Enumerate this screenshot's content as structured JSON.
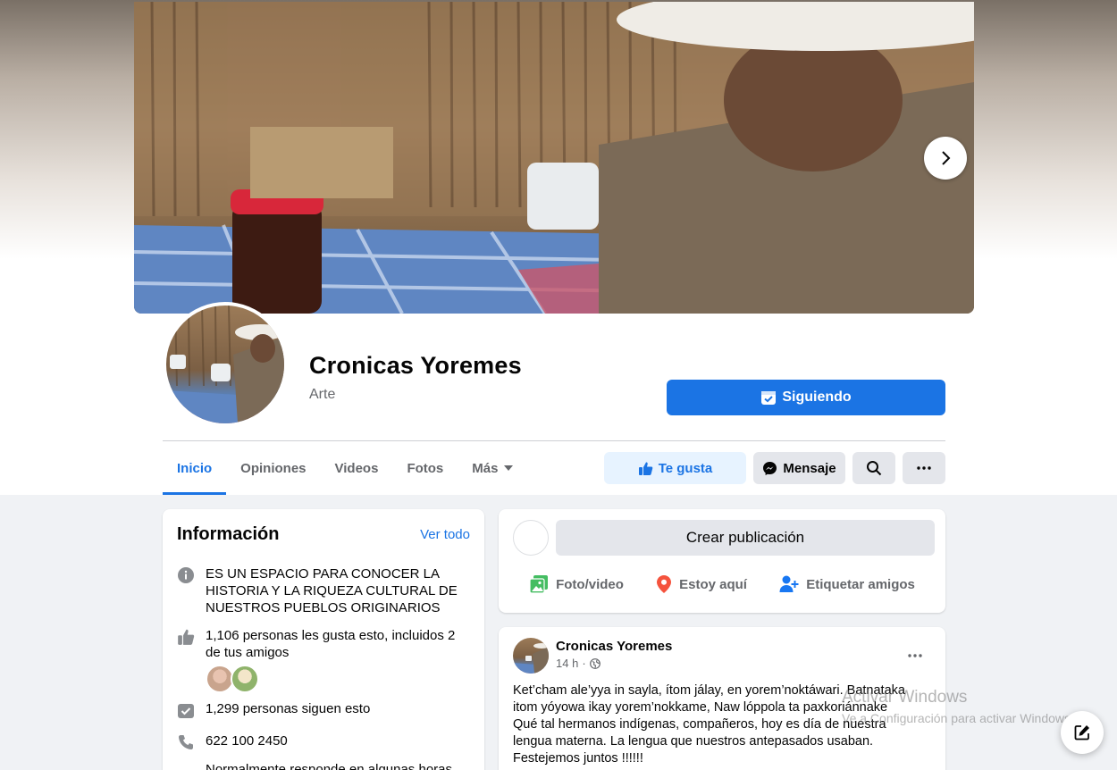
{
  "page": {
    "name": "Cronicas Yoremes",
    "category": "Arte",
    "following_label": "Siguiendo"
  },
  "tabs": [
    {
      "label": "Inicio",
      "active": true
    },
    {
      "label": "Opiniones"
    },
    {
      "label": "Videos"
    },
    {
      "label": "Fotos"
    },
    {
      "label": "Más"
    }
  ],
  "actions": {
    "like_label": "Te gusta",
    "message_label": "Mensaje"
  },
  "info": {
    "title": "Información",
    "see_all": "Ver todo",
    "about": "ES UN ESPACIO PARA CONOCER LA HISTORIA Y LA RIQUEZA CULTURAL DE NUESTROS PUEBLOS ORIGINARIOS",
    "likes": "1,106 personas les gusta esto, incluidos 2 de tus amigos",
    "followers": "1,299 personas siguen esto",
    "phone": "622 100 2450",
    "response": "Normalmente responde en algunas horas"
  },
  "create_post": {
    "prompt": "Crear publicación",
    "photo_video": "Foto/video",
    "check_in": "Estoy aquí",
    "tag_friends": "Etiquetar amigos"
  },
  "post": {
    "author": "Cronicas Yoremes",
    "time": "14 h",
    "text": "Ket’cham ale’yya in sayla, ítom jálay, en yorem’noktáwari. Batnataka\nitom yóyowa ikay yorem’nokkame, Naw lóppola ta paxkoriánnake\nQué tal hermanos indígenas, compañeros, hoy es día de nuestra\nlengua materna. La lengua que nuestros antepasados usaban.\nFestejemos juntos !!!!!!"
  },
  "watermark": {
    "line1": "Activar Windows",
    "line2": "Ve a Configuración para activar Windows."
  },
  "colors": {
    "accent": "#1b74e4",
    "background": "#f0f2f5",
    "secondary_text": "#65676b"
  },
  "icons": [
    "chevron-right-icon",
    "messenger-check-icon",
    "thumbs-up-icon",
    "messenger-icon",
    "search-icon",
    "more-icon",
    "info-icon",
    "followers-icon",
    "phone-icon",
    "photo-video-icon",
    "location-pin-icon",
    "tag-friends-icon",
    "globe-icon",
    "compose-icon"
  ]
}
